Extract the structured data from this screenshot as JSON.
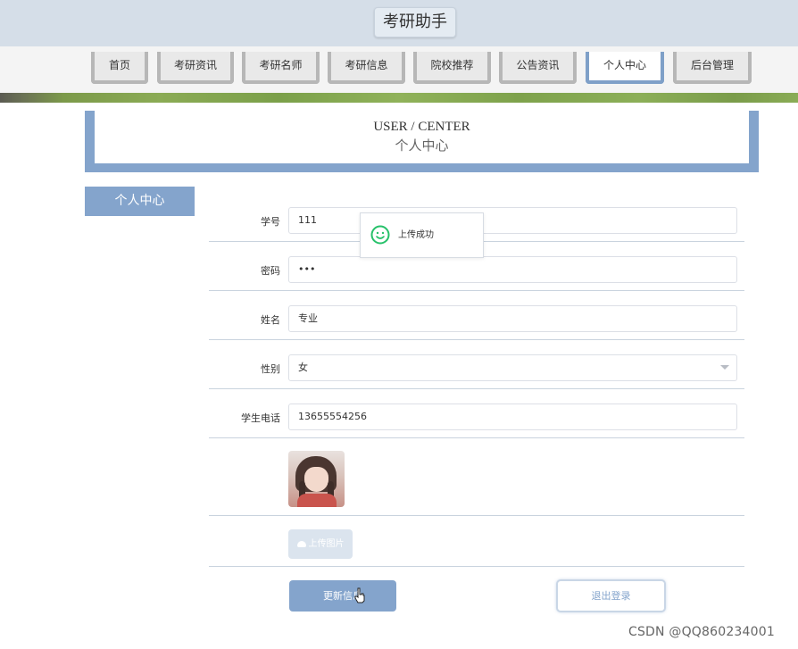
{
  "header": {
    "title": "考研助手"
  },
  "nav": {
    "items": [
      {
        "label": "首页",
        "active": false
      },
      {
        "label": "考研资讯",
        "active": false
      },
      {
        "label": "考研名师",
        "active": false
      },
      {
        "label": "考研信息",
        "active": false
      },
      {
        "label": "院校推荐",
        "active": false
      },
      {
        "label": "公告资讯",
        "active": false
      },
      {
        "label": "个人中心",
        "active": true
      },
      {
        "label": "后台管理",
        "active": false
      }
    ]
  },
  "banner": {
    "title_en": "USER / CENTER",
    "title_cn": "个人中心"
  },
  "sidebar": {
    "tab_label": "个人中心"
  },
  "form": {
    "student_id": {
      "label": "学号",
      "value": "111"
    },
    "password": {
      "label": "密码",
      "value": "•••"
    },
    "name": {
      "label": "姓名",
      "value": "专业"
    },
    "gender": {
      "label": "性别",
      "value": "女"
    },
    "phone": {
      "label": "学生电话",
      "value": "13655554256"
    },
    "upload_label": "上传图片",
    "update_label": "更新信息",
    "logout_label": "退出登录"
  },
  "toast": {
    "message": "上传成功",
    "icon": "smile-icon"
  },
  "watermark": "CSDN @QQ860234001",
  "colors": {
    "accent": "#84a4cc",
    "header_bg": "#d5dee8",
    "toast_icon": "#27c16a"
  }
}
